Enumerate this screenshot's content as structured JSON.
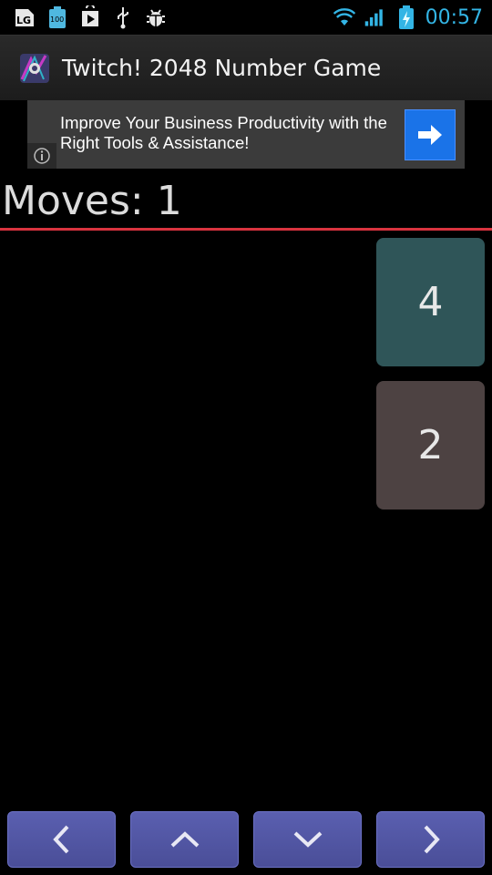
{
  "status_bar": {
    "left_icons": [
      "lg-icon",
      "battery-100-icon",
      "play-store-icon",
      "usb-icon",
      "debug-icon"
    ],
    "lg_label": "LG",
    "battery_label": "100",
    "right_icons": [
      "wifi-icon",
      "signal-icon",
      "battery-charging-icon"
    ],
    "time": "00:57",
    "accent": "#33b5e5"
  },
  "action_bar": {
    "title": "Twitch! 2048 Number Game"
  },
  "ad": {
    "text": "Improve Your Business Productivity with the Right Tools & Assistance!",
    "info_icon": "info-icon",
    "arrow_icon": "arrow-right-icon",
    "arrow_color": "#1a73e8"
  },
  "game": {
    "moves_label": "Moves:",
    "moves_value": "1",
    "divider_color": "#d9333f",
    "tiles": [
      {
        "value": "4",
        "column": 4,
        "row": 1,
        "color": "#2f5558"
      },
      {
        "value": "2",
        "column": 4,
        "row": 2,
        "color": "#4d4242"
      }
    ]
  },
  "controls": {
    "buttons": [
      "chevron-left-icon",
      "chevron-up-icon",
      "chevron-down-icon",
      "chevron-right-icon"
    ],
    "color": "#5a5fb0"
  }
}
